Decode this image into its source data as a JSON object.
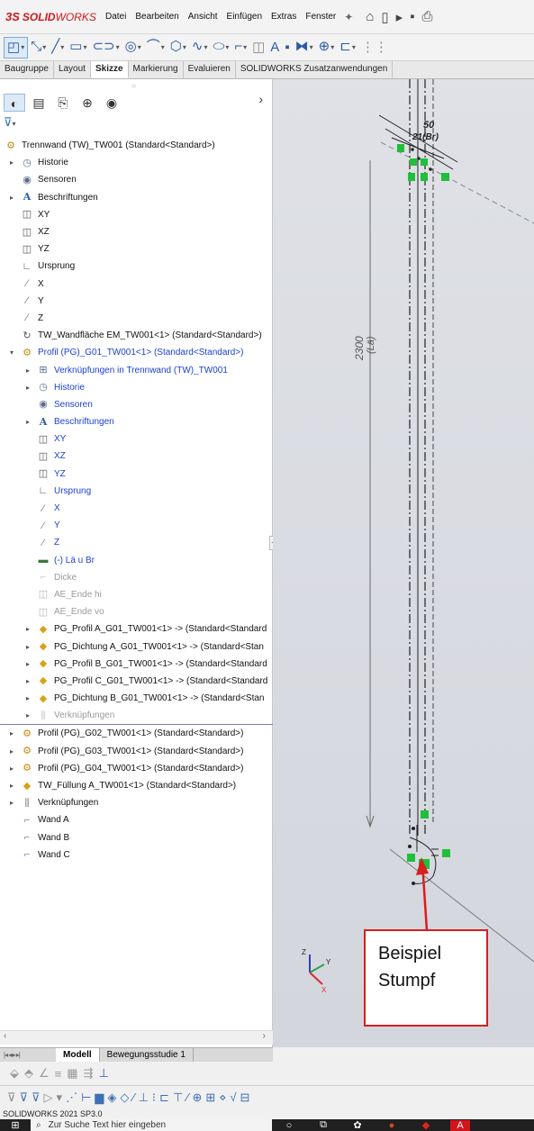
{
  "titlebar": {
    "logo_ds": "3S",
    "logo_solid": "SOLID",
    "logo_works": "WORKS",
    "menus": [
      "Datei",
      "Bearbeiten",
      "Ansicht",
      "Einfügen",
      "Extras",
      "Fenster"
    ]
  },
  "command_tabs": [
    "Baugruppe",
    "Layout",
    "Skizze",
    "Markierung",
    "Evaluieren",
    "SOLIDWORKS Zusatzanwendungen"
  ],
  "active_command_tab": "Skizze",
  "tree": [
    {
      "label": "Trennwand (TW)_TW001  (Standard<Standard>)",
      "icon": "assembly-icon",
      "indent": 0,
      "expander": "none",
      "style": "normal"
    },
    {
      "label": "Historie",
      "icon": "history-icon",
      "indent": 1,
      "expander": "collapsed",
      "style": "normal"
    },
    {
      "label": "Sensoren",
      "icon": "sensor-icon",
      "indent": 1,
      "expander": "none",
      "style": "normal"
    },
    {
      "label": "Beschriftungen",
      "icon": "annotations-icon",
      "indent": 1,
      "expander": "collapsed",
      "style": "normal"
    },
    {
      "label": "XY",
      "icon": "plane-icon",
      "indent": 1,
      "expander": "none",
      "style": "normal"
    },
    {
      "label": "XZ",
      "icon": "plane-icon",
      "indent": 1,
      "expander": "none",
      "style": "normal"
    },
    {
      "label": "YZ",
      "icon": "plane-icon",
      "indent": 1,
      "expander": "none",
      "style": "normal"
    },
    {
      "label": "Ursprung",
      "icon": "origin-icon",
      "indent": 1,
      "expander": "none",
      "style": "normal"
    },
    {
      "label": "X",
      "icon": "axis-icon",
      "indent": 1,
      "expander": "none",
      "style": "normal"
    },
    {
      "label": "Y",
      "icon": "axis-icon",
      "indent": 1,
      "expander": "none",
      "style": "normal"
    },
    {
      "label": "Z",
      "icon": "axis-icon",
      "indent": 1,
      "expander": "none",
      "style": "normal"
    },
    {
      "label": "TW_Wandfläche EM_TW001<1> (Standard<Standard>)",
      "icon": "virtual-part-icon",
      "indent": 1,
      "expander": "none",
      "style": "normal"
    },
    {
      "label": "Profil (PG)_G01_TW001<1> (Standard<Standard>)",
      "icon": "subassembly-icon",
      "indent": 1,
      "expander": "expanded",
      "style": "blue"
    },
    {
      "label": "Verknüpfungen in Trennwand (TW)_TW001",
      "icon": "mates-folder-icon",
      "indent": 2,
      "expander": "collapsed",
      "style": "blue"
    },
    {
      "label": "Historie",
      "icon": "history-icon",
      "indent": 2,
      "expander": "collapsed",
      "style": "blue"
    },
    {
      "label": "Sensoren",
      "icon": "sensor-icon",
      "indent": 2,
      "expander": "none",
      "style": "blue"
    },
    {
      "label": "Beschriftungen",
      "icon": "annotations-icon",
      "indent": 2,
      "expander": "collapsed",
      "style": "blue"
    },
    {
      "label": "XY",
      "icon": "plane-icon",
      "indent": 2,
      "expander": "none",
      "style": "blue"
    },
    {
      "label": "XZ",
      "icon": "plane-icon",
      "indent": 2,
      "expander": "none",
      "style": "blue"
    },
    {
      "label": "YZ",
      "icon": "plane-icon",
      "indent": 2,
      "expander": "none",
      "style": "blue"
    },
    {
      "label": "Ursprung",
      "icon": "origin-icon",
      "indent": 2,
      "expander": "none",
      "style": "blue"
    },
    {
      "label": "X",
      "icon": "axis-icon",
      "indent": 2,
      "expander": "none",
      "style": "blue"
    },
    {
      "label": "Y",
      "icon": "axis-icon",
      "indent": 2,
      "expander": "none",
      "style": "blue"
    },
    {
      "label": "Z",
      "icon": "axis-icon",
      "indent": 2,
      "expander": "none",
      "style": "blue"
    },
    {
      "label": "(-) Lä u Br",
      "icon": "dimension-sketch-icon",
      "indent": 2,
      "expander": "none",
      "style": "blue"
    },
    {
      "label": "Dicke",
      "icon": "sketch-icon",
      "indent": 2,
      "expander": "none",
      "style": "grey"
    },
    {
      "label": "AE_Ende hi",
      "icon": "plane-icon",
      "indent": 2,
      "expander": "none",
      "style": "grey"
    },
    {
      "label": "AE_Ende vo",
      "icon": "plane-icon",
      "indent": 2,
      "expander": "none",
      "style": "grey"
    },
    {
      "label": "PG_Profil A_G01_TW001<1> -> (Standard<Standard",
      "icon": "part-icon",
      "indent": 2,
      "expander": "collapsed",
      "style": "normal"
    },
    {
      "label": "PG_Dichtung A_G01_TW001<1> -> (Standard<Stan",
      "icon": "part-icon",
      "indent": 2,
      "expander": "collapsed",
      "style": "normal"
    },
    {
      "label": "PG_Profil B_G01_TW001<1> -> (Standard<Standard",
      "icon": "part-icon",
      "indent": 2,
      "expander": "collapsed",
      "style": "normal"
    },
    {
      "label": "PG_Profil C_G01_TW001<1> -> (Standard<Standard",
      "icon": "part-icon",
      "indent": 2,
      "expander": "collapsed",
      "style": "normal"
    },
    {
      "label": "PG_Dichtung B_G01_TW001<1> -> (Standard<Stan",
      "icon": "part-icon",
      "indent": 2,
      "expander": "collapsed",
      "style": "normal"
    },
    {
      "label": "Verknüpfungen",
      "icon": "mates-icon",
      "indent": 2,
      "expander": "collapsed",
      "style": "grey"
    },
    {
      "label": "Profil (PG)_G02_TW001<1> (Standard<Standard>)",
      "icon": "subassembly-icon",
      "indent": 1,
      "expander": "collapsed",
      "style": "normal"
    },
    {
      "label": "Profil (PG)_G03_TW001<1> (Standard<Standard>)",
      "icon": "subassembly-icon",
      "indent": 1,
      "expander": "collapsed",
      "style": "normal"
    },
    {
      "label": "Profil (PG)_G04_TW001<1> (Standard<Standard>)",
      "icon": "subassembly-icon",
      "indent": 1,
      "expander": "collapsed",
      "style": "normal"
    },
    {
      "label": "TW_Füllung A_TW001<1> (Standard<Standard>)",
      "icon": "part-icon",
      "indent": 1,
      "expander": "collapsed",
      "style": "normal"
    },
    {
      "label": "Verknüpfungen",
      "icon": "mates-icon",
      "indent": 1,
      "expander": "collapsed",
      "style": "normal"
    },
    {
      "label": "Wand A",
      "icon": "sketch-icon",
      "indent": 1,
      "expander": "none",
      "style": "normal"
    },
    {
      "label": "Wand B",
      "icon": "sketch-icon",
      "indent": 1,
      "expander": "none",
      "style": "normal"
    },
    {
      "label": "Wand C",
      "icon": "sketch-icon",
      "indent": 1,
      "expander": "none",
      "style": "normal"
    }
  ],
  "bottom_tabs": [
    "Modell",
    "Bewegungsstudie 1"
  ],
  "active_bottom_tab": "Modell",
  "status": "SOLIDWORKS 2021 SP3.0",
  "taskbar": {
    "search_placeholder": "Zur Suche Text hier eingeben"
  },
  "graphics": {
    "dim_length": "2300",
    "dim_length_sub": "(Lä)",
    "dim_top": "50",
    "dim_top_sub": "21(Br)",
    "callout_line1": "Beispiel",
    "callout_line2": "Stumpf",
    "callout_color": "#d81e1e"
  },
  "colors": {
    "blue_text": "#1a3fd6",
    "grey_text": "#9a9a9a",
    "sketch_green": "#1fbf3a"
  }
}
